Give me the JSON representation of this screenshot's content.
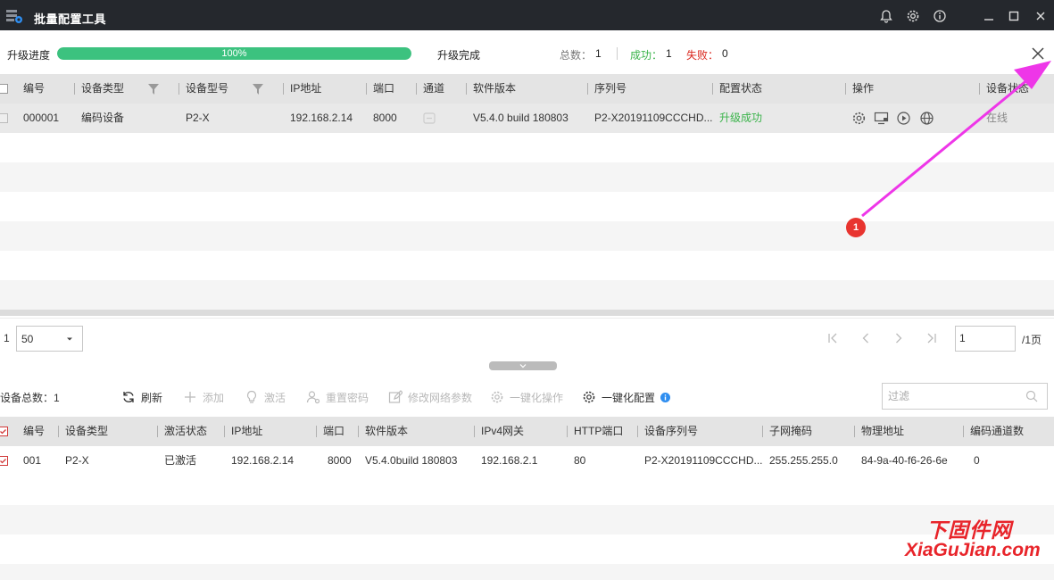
{
  "window": {
    "title": "批量配置工具"
  },
  "progress": {
    "label": "升级进度",
    "percent_text": "100%",
    "percent": 100,
    "status": "升级完成",
    "total_label": "总数：",
    "total": "1",
    "success_label": "成功：",
    "success": "1",
    "fail_label": "失败：",
    "fail": "0"
  },
  "table1": {
    "headers": [
      "编号",
      "设备类型",
      "设备型号",
      "IP地址",
      "端口",
      "通道",
      "软件版本",
      "序列号",
      "配置状态",
      "操作",
      "设备状态"
    ],
    "rows": [
      {
        "id": "000001",
        "type": "编码设备",
        "model": "P2-X",
        "ip": "192.168.2.14",
        "port": "8000",
        "channel": "",
        "version": "V5.4.0 build 180803",
        "serial": "P2-X20191109CCCHD...",
        "config_status": "升级成功",
        "device_status": "在线"
      }
    ]
  },
  "pager": {
    "count": "1",
    "page_size": "50",
    "page_input": "1",
    "page_total": "/1页"
  },
  "toolbar": {
    "device_total": "设备总数：1",
    "refresh": "刷新",
    "add": "添加",
    "activate": "激活",
    "reset_password": "重置密码",
    "modify_network": "修改网络参数",
    "one_key_operate": "一键化操作",
    "one_key_config": "一键化配置",
    "filter_placeholder": "过滤"
  },
  "table2": {
    "headers": [
      "编号",
      "设备类型",
      "激活状态",
      "IP地址",
      "端口",
      "软件版本",
      "IPv4网关",
      "HTTP端口",
      "设备序列号",
      "子网掩码",
      "物理地址",
      "编码通道数"
    ],
    "rows": [
      {
        "id": "001",
        "type": "P2-X",
        "activation": "已激活",
        "ip": "192.168.2.14",
        "port": "8000",
        "version": "V5.4.0build 180803",
        "gateway": "192.168.2.1",
        "http_port": "80",
        "serial": "P2-X20191109CCCHD...",
        "mask": "255.255.255.0",
        "mac": "84-9a-40-f6-26-6e",
        "channels": "0"
      }
    ]
  },
  "annotation": {
    "badge": "1"
  },
  "watermark": {
    "cn": "下固件网",
    "en": "XiaGuJian.com"
  },
  "colors": {
    "titlebar": "#25282d",
    "progress_fill": "#3cc27f",
    "success_text": "#3ab34a",
    "fail_text": "#d9261c",
    "annotation_arrow": "#ee36e8",
    "badge": "#e8342f"
  }
}
